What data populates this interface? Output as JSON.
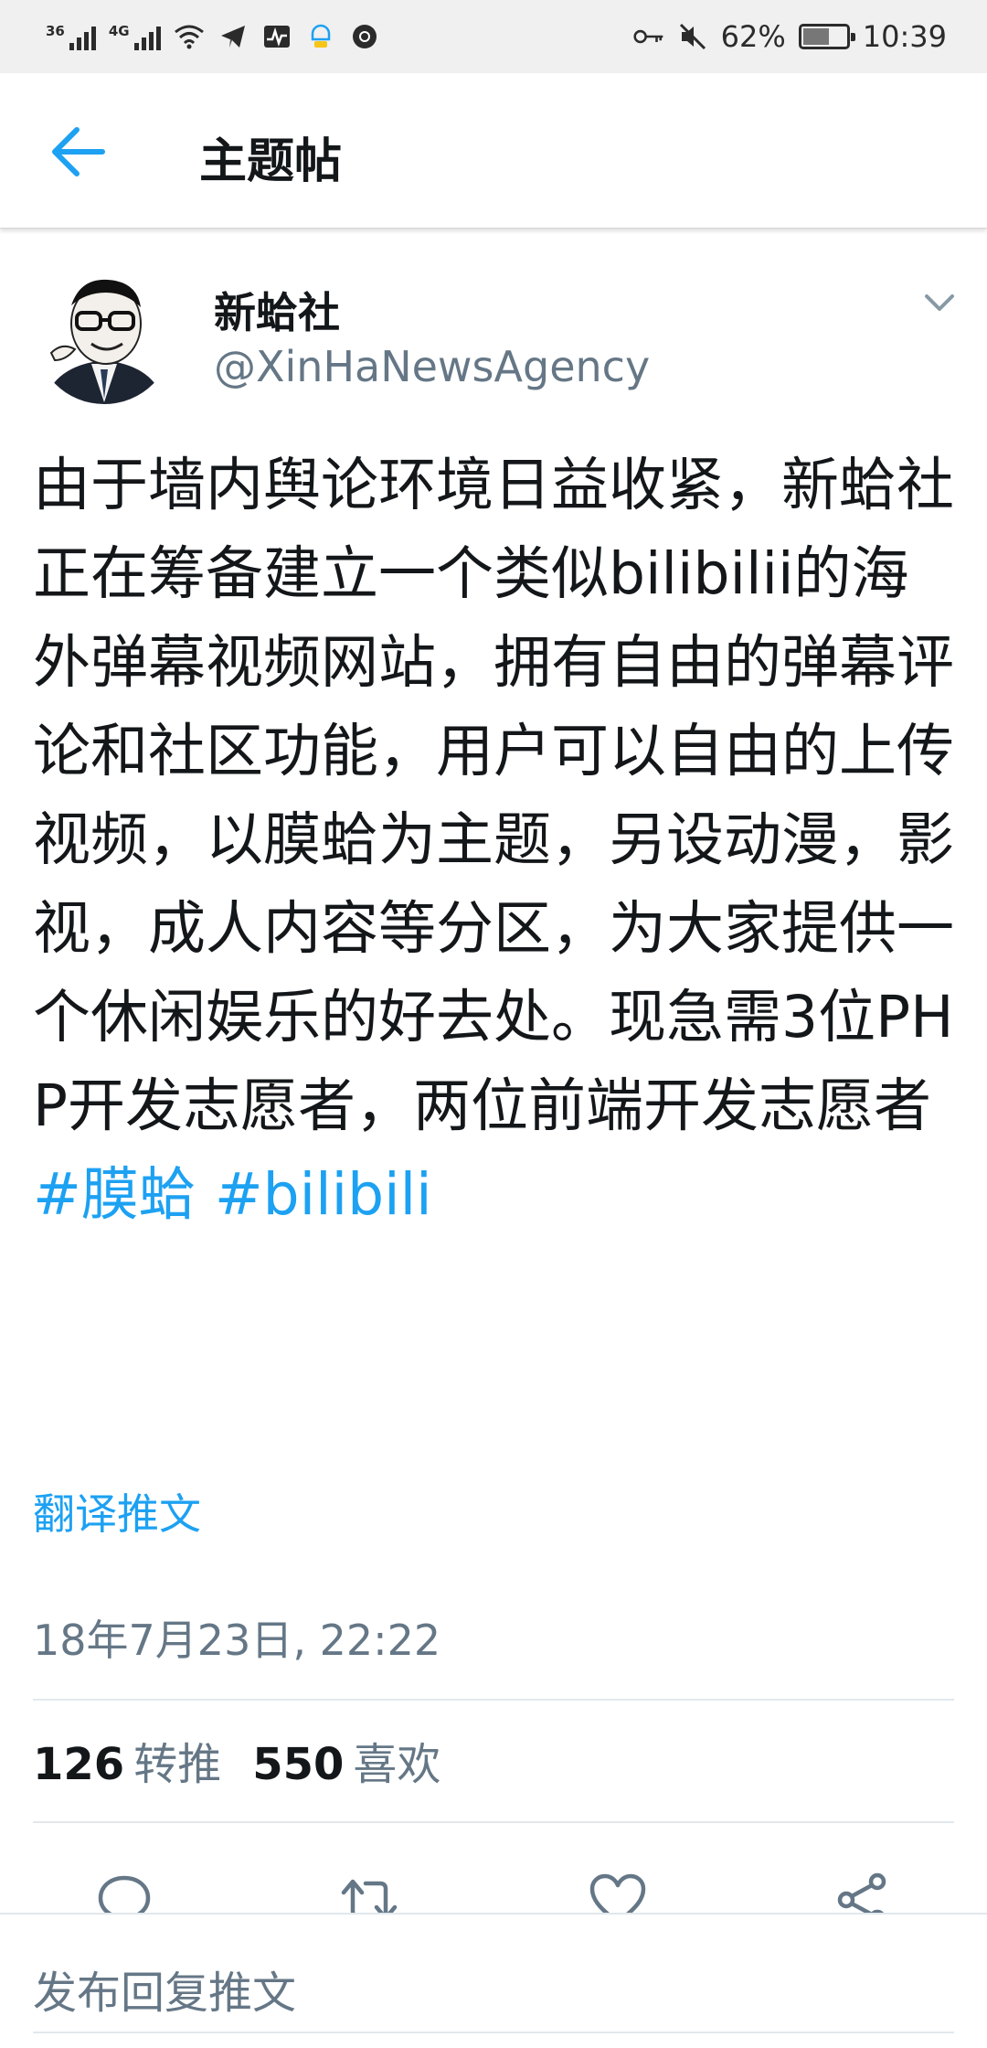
{
  "status_bar": {
    "net1": "36",
    "net2": "4G",
    "battery_percent": "62%",
    "battery_level": 0.62,
    "time": "10:39",
    "icons": [
      "signal-icon",
      "signal-icon",
      "wifi-icon",
      "telegram-icon",
      "activity-icon",
      "assistant-icon",
      "chrome-icon",
      "key-icon",
      "mute-icon",
      "battery-icon"
    ]
  },
  "header": {
    "title": "主题帖"
  },
  "tweet": {
    "author_name": "新蛤社",
    "author_handle": "@XinHaNewsAgency",
    "text": "由于墙内舆论环境日益收紧，新蛤社正在筹备建立一个类似bilibilii的海外弹幕视频网站，拥有自由的弹幕评论和社区功能，用户可以自由的上传视频，以膜蛤为主题，另设动漫，影视，成人内容等分区，为大家提供一个休闲娱乐的好去处。现急需3位PHP开发志愿者，两位前端开发志愿者",
    "hashtag1": "#膜蛤",
    "hashtag2": "#bilibili",
    "translate_label": "翻译推文",
    "timestamp": "18年7月23日, 22:22",
    "retweets_count": "126",
    "retweets_label": "转推",
    "likes_count": "550",
    "likes_label": "喜欢"
  },
  "reply": {
    "placeholder": "发布回复推文"
  },
  "colors": {
    "accent": "#1da1f2",
    "secondary_text": "#657786",
    "primary_text": "#14171a",
    "divider": "#e1e8ed"
  }
}
